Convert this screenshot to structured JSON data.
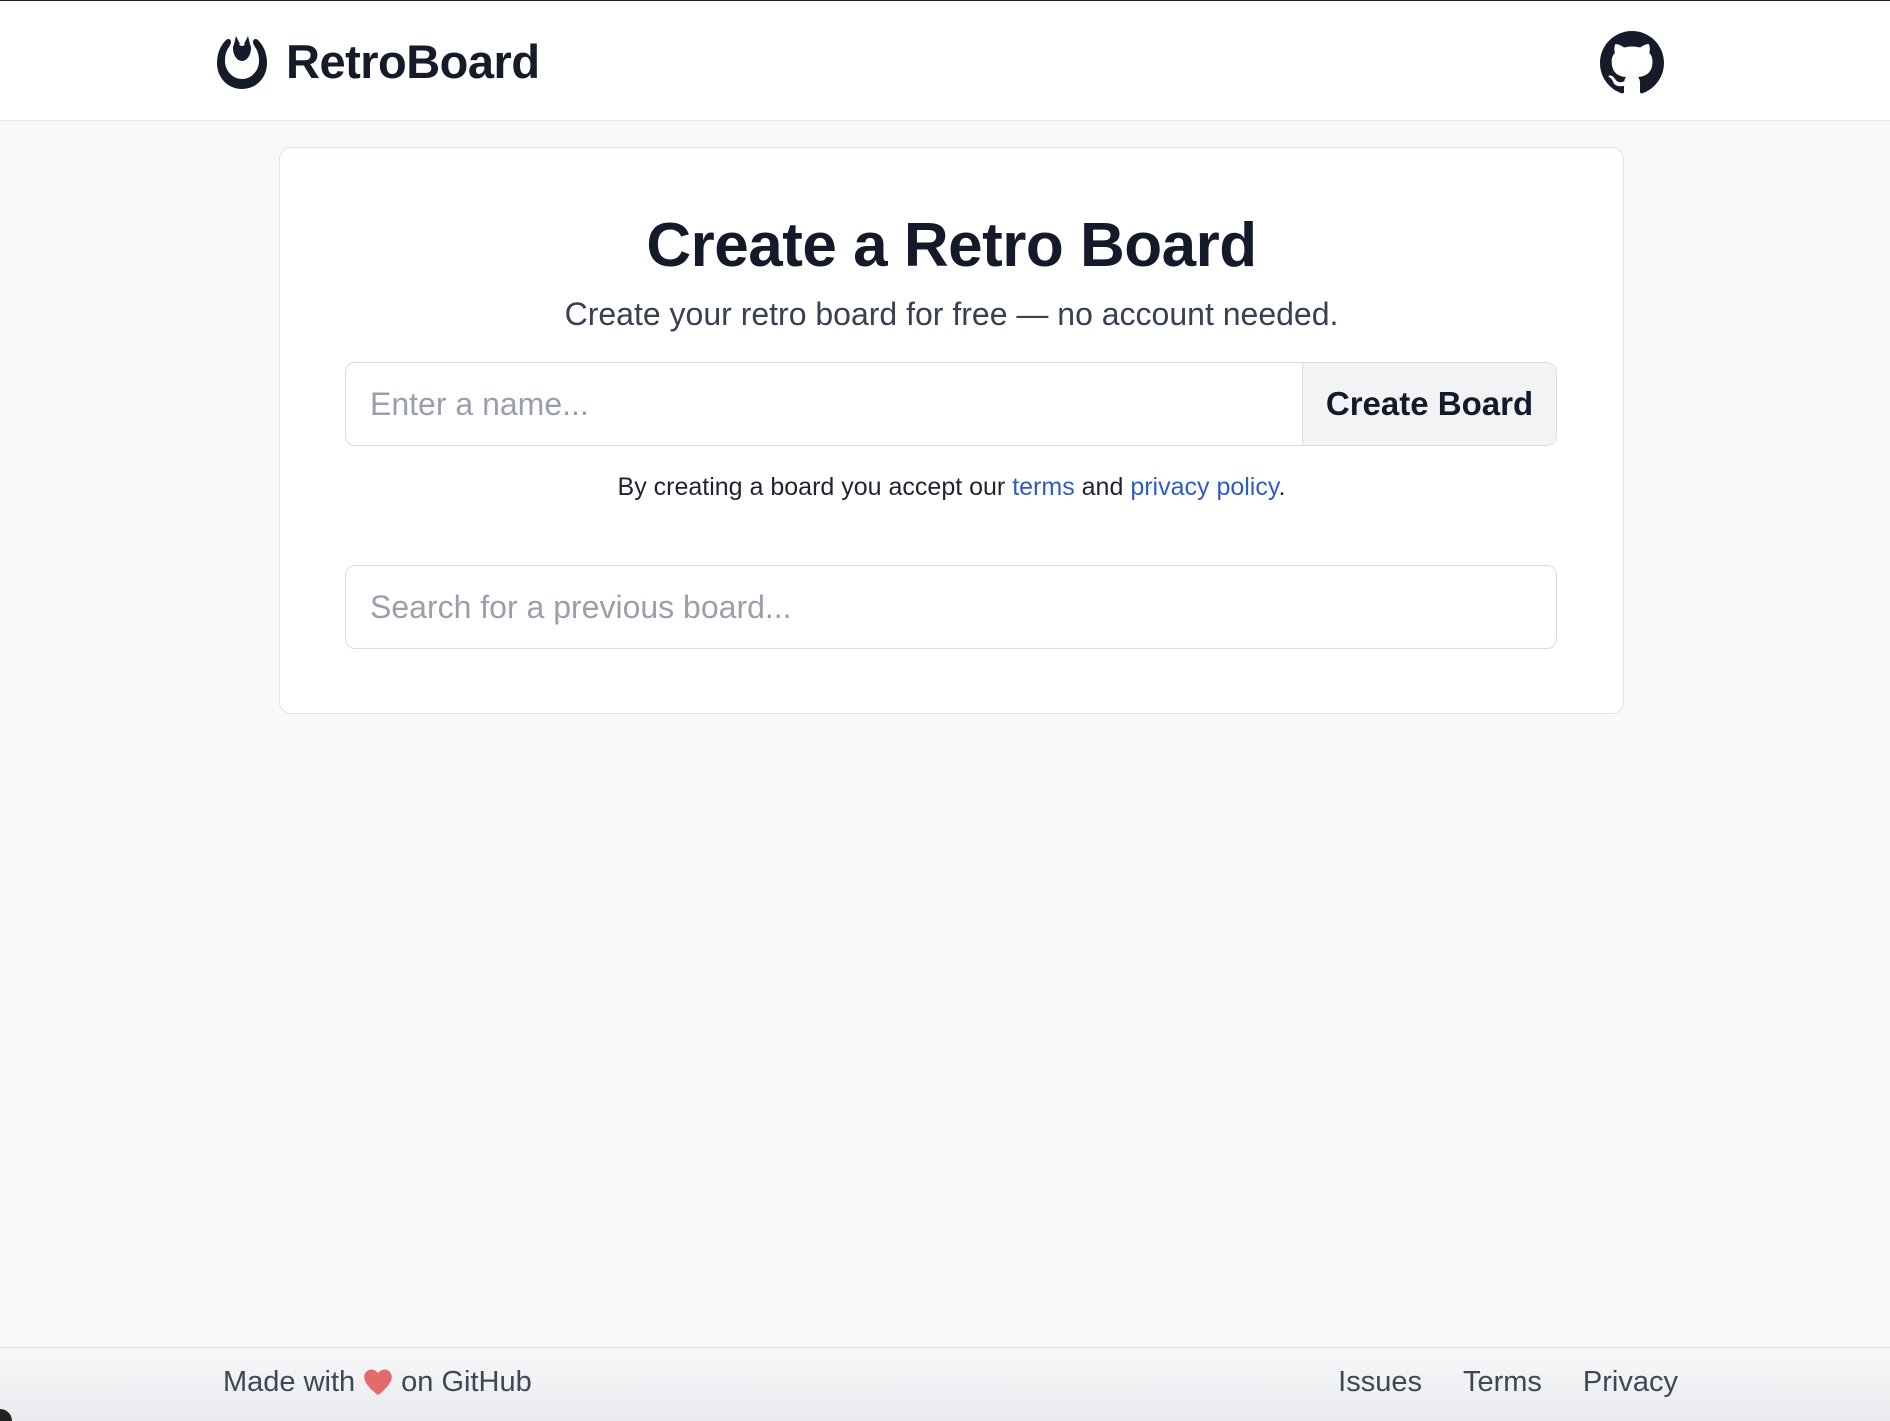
{
  "header": {
    "brand_name": "RetroBoard",
    "logo_icon": "retroboard-logo-icon",
    "github_icon": "github-icon"
  },
  "card": {
    "title": "Create a Retro Board",
    "subtitle": "Create your retro board for free — no account needed.",
    "name_input": {
      "placeholder": "Enter a name...",
      "value": ""
    },
    "create_button_label": "Create Board",
    "terms_prefix": "By creating a board you accept our ",
    "terms_link": "terms",
    "terms_and": " and ",
    "privacy_link": "privacy policy",
    "terms_suffix": ".",
    "search_input": {
      "placeholder": "Search for a previous board...",
      "value": ""
    }
  },
  "footer": {
    "made_with": "Made with",
    "heart_icon": "heart-icon",
    "on_github": "on GitHub",
    "links": [
      "Issues",
      "Terms",
      "Privacy"
    ]
  },
  "colors": {
    "background": "#f8f9fb",
    "text_primary": "#141a29",
    "link": "#2f5cc0",
    "heart": "#e26b6b"
  }
}
